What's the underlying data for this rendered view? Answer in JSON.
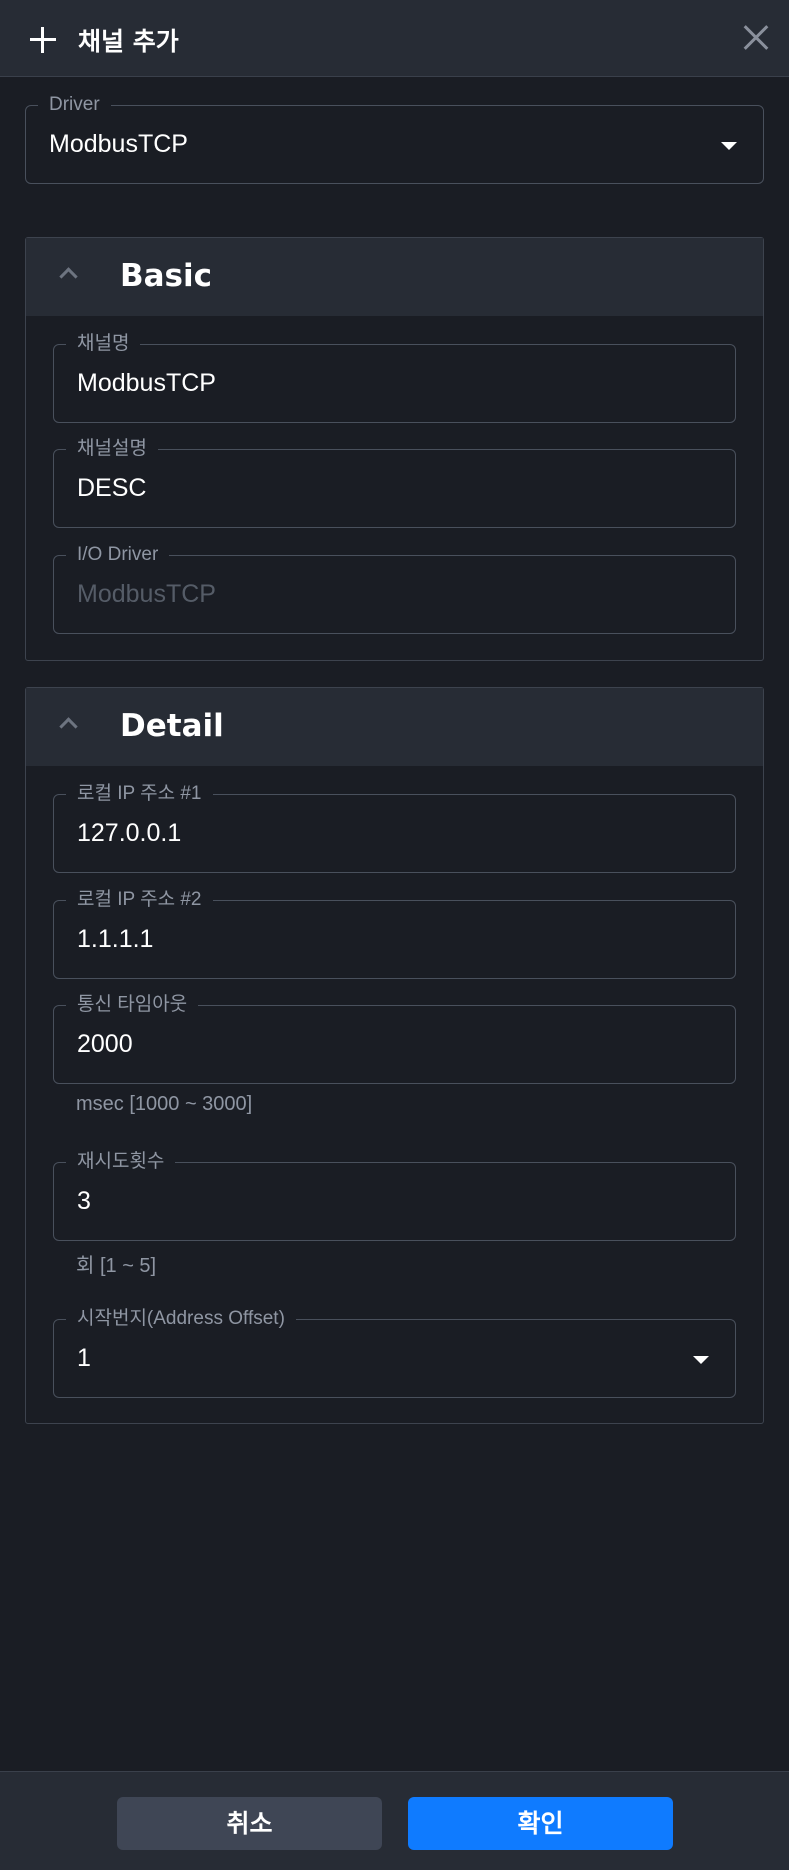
{
  "header": {
    "title": "채널 추가"
  },
  "driver": {
    "label": "Driver",
    "value": "ModbusTCP"
  },
  "basic": {
    "title": "Basic",
    "channel_name": {
      "label": "채널명",
      "value": "ModbusTCP"
    },
    "channel_desc": {
      "label": "채널설명",
      "value": "DESC"
    },
    "io_driver": {
      "label": "I/O Driver",
      "value": "ModbusTCP"
    }
  },
  "detail": {
    "title": "Detail",
    "local_ip1": {
      "label": "로컬 IP 주소 #1",
      "value": "127.0.0.1"
    },
    "local_ip2": {
      "label": "로컬 IP 주소 #2",
      "value": "1.1.1.1"
    },
    "timeout": {
      "label": "통신 타임아웃",
      "value": "2000",
      "hint": "msec [1000 ~ 3000]"
    },
    "retry": {
      "label": "재시도횟수",
      "value": "3",
      "hint": "회 [1 ~ 5]"
    },
    "address_offset": {
      "label": "시작번지(Address Offset)",
      "value": "1"
    }
  },
  "footer": {
    "cancel_label": "취소",
    "confirm_label": "확인"
  },
  "colors": {
    "accent": "#0f7bff",
    "background": "#1a1d24",
    "panel": "#272c35"
  }
}
